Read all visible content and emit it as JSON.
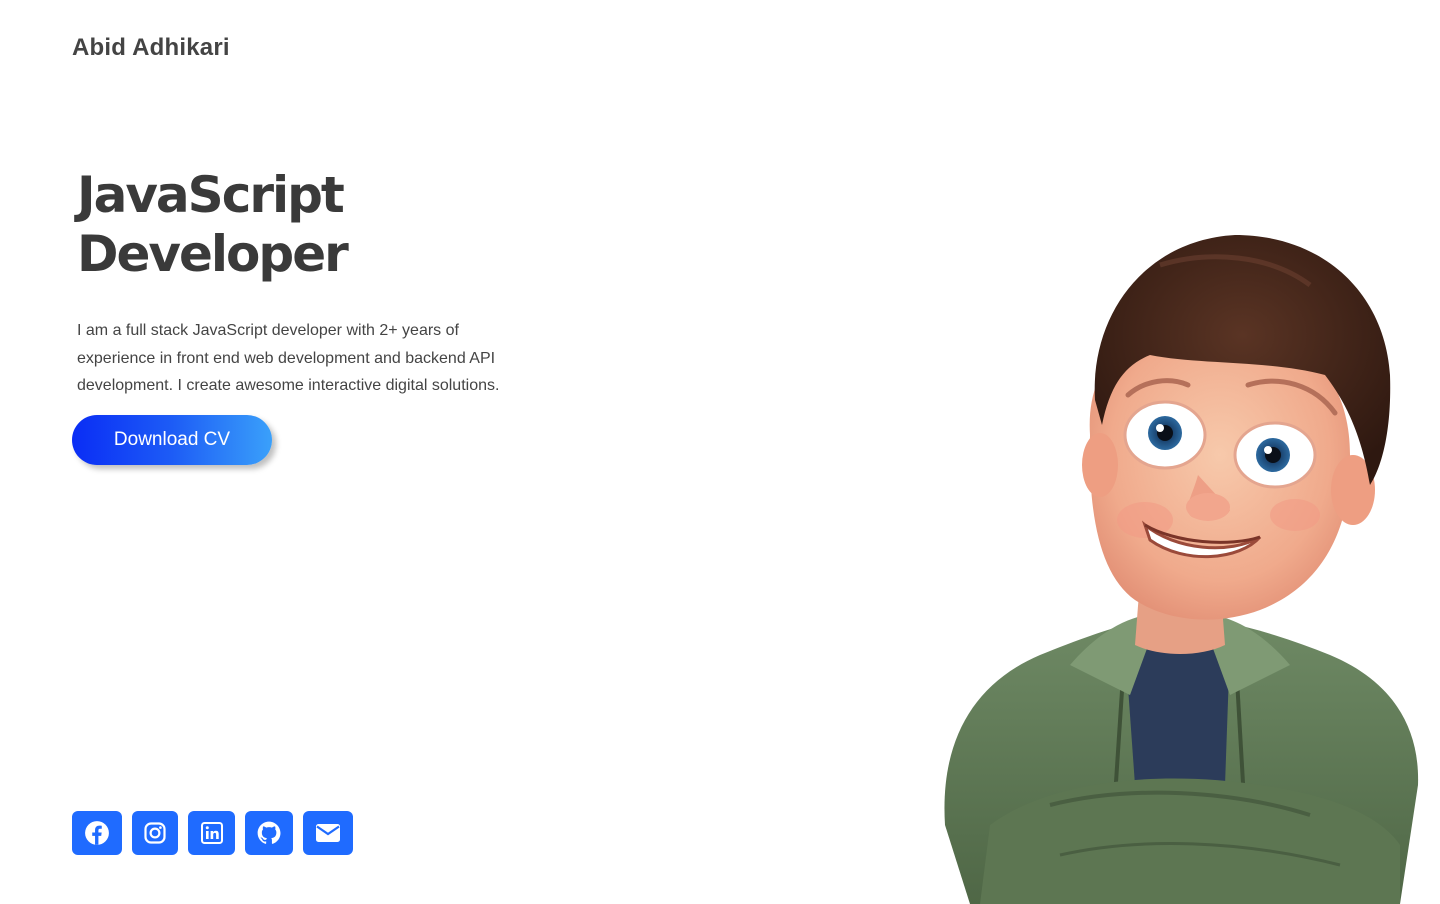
{
  "header": {
    "brand": "Abid Adhikari"
  },
  "hero": {
    "title_line1": "JavaScript",
    "title_line2": "Developer",
    "description": "I am a full stack JavaScript developer with 2+ years of experience in front end web development and backend API development. I create awesome interactive digital solutions.",
    "cv_button_label": "Download CV"
  },
  "socials": [
    {
      "icon": "facebook-icon"
    },
    {
      "icon": "instagram-icon"
    },
    {
      "icon": "linkedin-icon"
    },
    {
      "icon": "github-icon"
    },
    {
      "icon": "envelope-icon"
    }
  ],
  "colors": {
    "accent": "#1f6bff",
    "gradient_start": "#0a2df5",
    "gradient_end": "#3aa0fa",
    "text": "#3c3c3c"
  }
}
